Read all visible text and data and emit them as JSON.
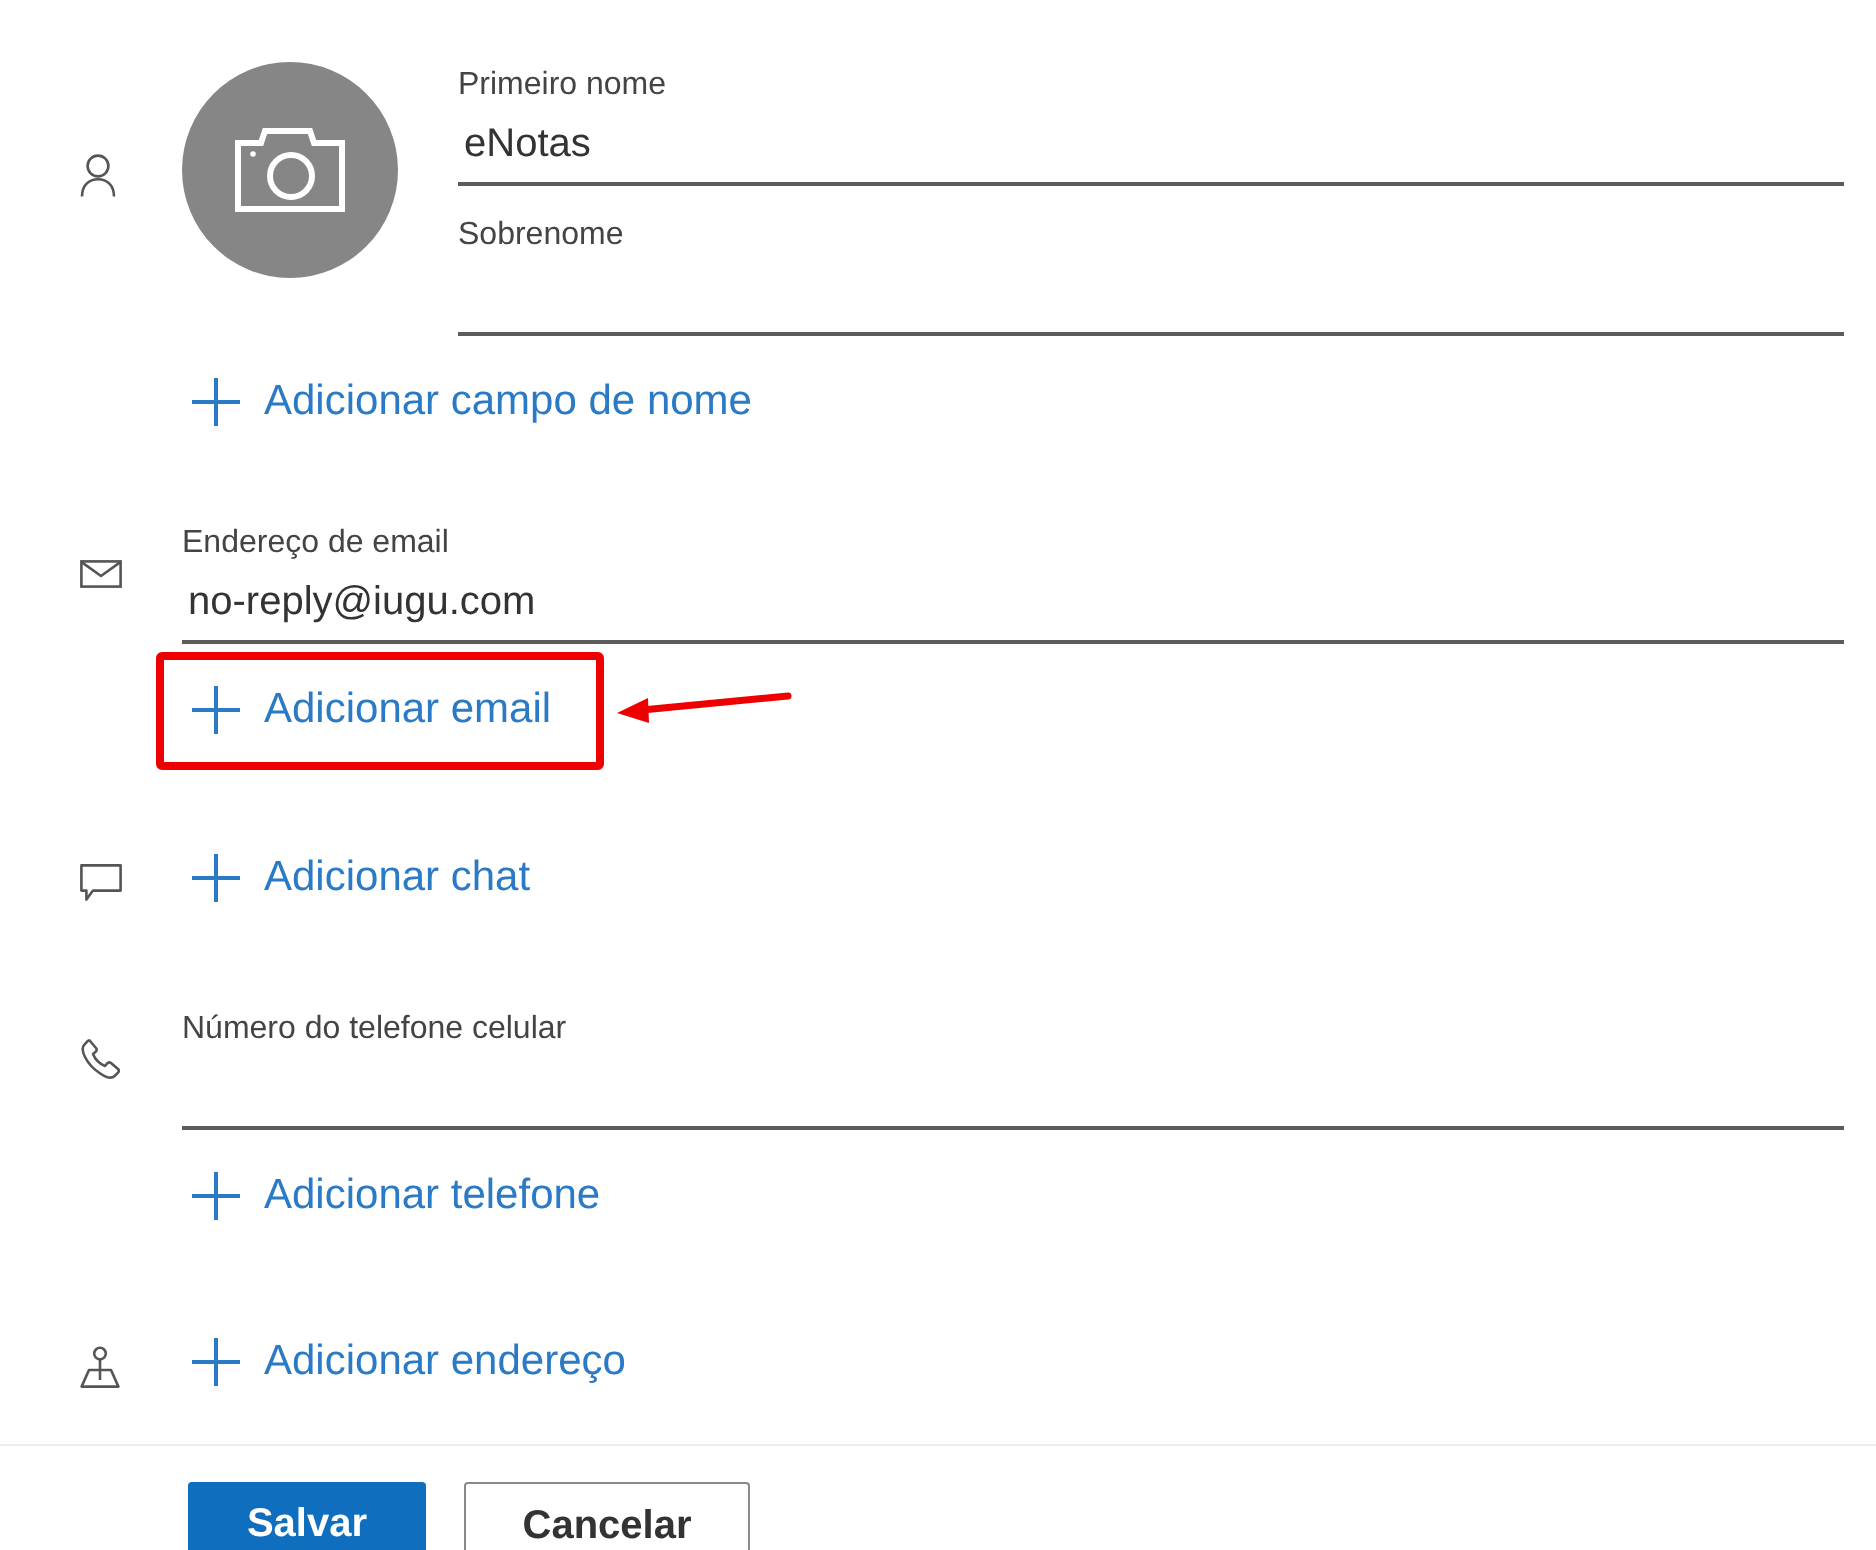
{
  "sections": [
    {
      "kind": "name",
      "fields": [
        {
          "label": "Primeiro nome",
          "value": "eNotas"
        },
        {
          "label": "Sobrenome"
        }
      ],
      "add_link": {
        "label": "Adicionar campo de nome",
        "highlighted": false
      }
    },
    {
      "kind": "email",
      "fields": [
        {
          "label": "Endereço de email",
          "value": "no-reply@iugu.com"
        }
      ],
      "add_link": {
        "label": "Adicionar email",
        "highlighted": true
      }
    },
    {
      "kind": "chat",
      "add_link": {
        "label": "Adicionar chat",
        "highlighted": false
      }
    },
    {
      "kind": "phone",
      "fields": [
        {
          "label": "Número do telefone celular"
        }
      ],
      "add_link": {
        "label": "Adicionar telefone",
        "highlighted": false
      }
    },
    {
      "kind": "address",
      "add_link": {
        "label": "Adicionar endereço",
        "highlighted": false
      }
    }
  ],
  "buttons": [
    {
      "label": "Salvar",
      "kind": "primary"
    },
    {
      "label": "Cancelar",
      "kind": "secondary"
    }
  ]
}
